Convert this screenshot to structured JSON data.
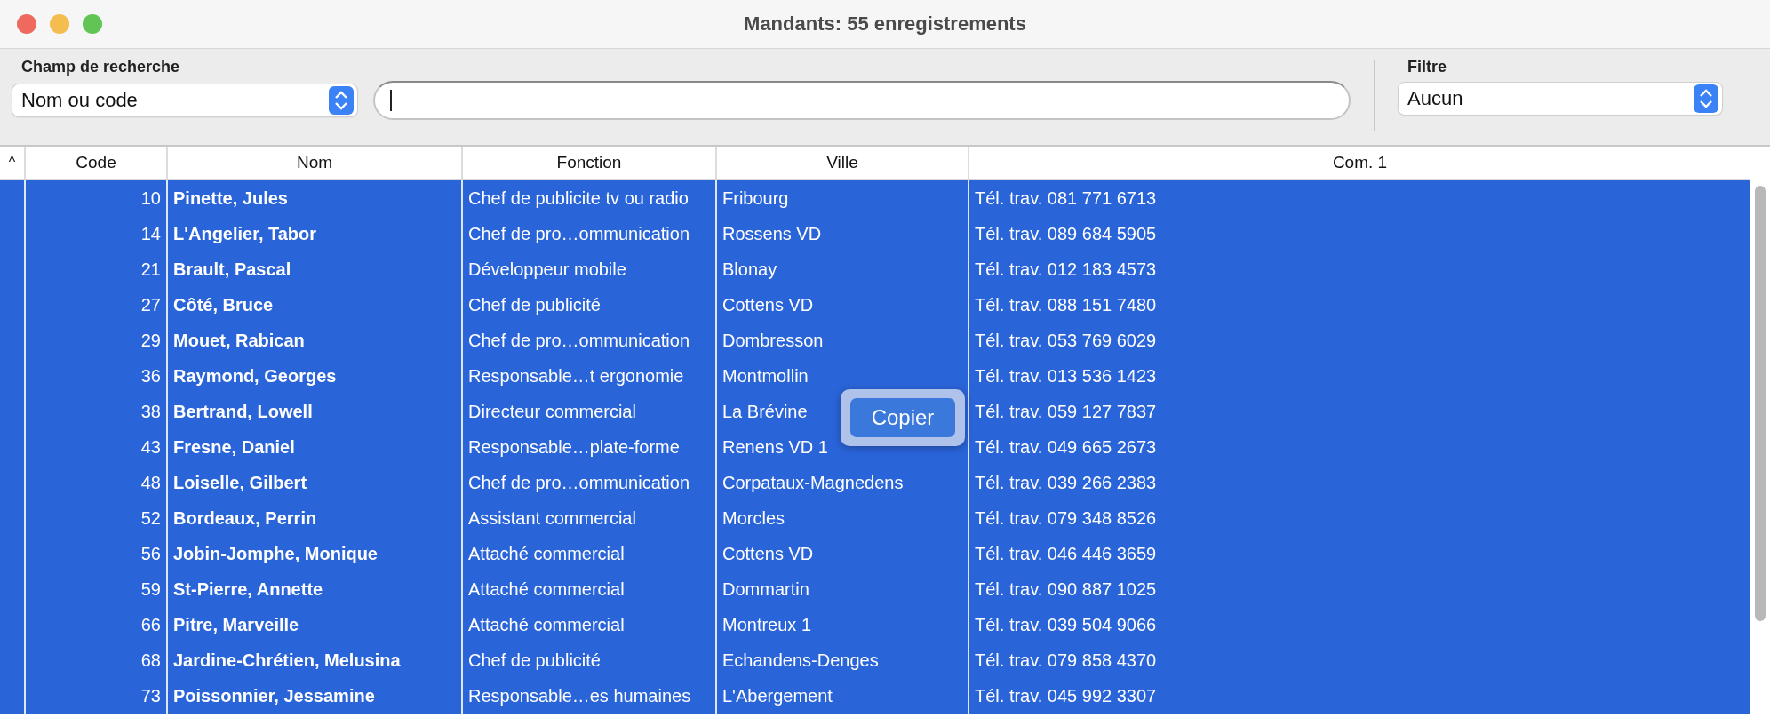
{
  "window": {
    "title": "Mandants: 55 enregistrements"
  },
  "search": {
    "field_label": "Champ de recherche",
    "field_value": "Nom ou code",
    "filter_label": "Filtre",
    "filter_value": "Aucun"
  },
  "table": {
    "sort_indicator": "^",
    "columns": [
      "Code",
      "Nom",
      "Fonction",
      "Ville",
      "Com. 1"
    ],
    "rows": [
      {
        "code": "10",
        "nom": "Pinette, Jules",
        "fonction": "Chef de publicite tv ou radio",
        "ville": "Fribourg",
        "com1": "Tél. trav. 081 771 6713",
        "selected": true
      },
      {
        "code": "14",
        "nom": "L'Angelier, Tabor",
        "fonction": "Chef de pro…ommunication",
        "ville": "Rossens VD",
        "com1": "Tél. trav. 089 684 5905",
        "selected": true
      },
      {
        "code": "21",
        "nom": "Brault, Pascal",
        "fonction": "Développeur mobile",
        "ville": "Blonay",
        "com1": "Tél. trav. 012 183 4573",
        "selected": true
      },
      {
        "code": "27",
        "nom": "Côté, Bruce",
        "fonction": "Chef de publicité",
        "ville": "Cottens VD",
        "com1": "Tél. trav. 088 151 7480",
        "selected": true
      },
      {
        "code": "29",
        "nom": "Mouet, Rabican",
        "fonction": "Chef de pro…ommunication",
        "ville": "Dombresson",
        "com1": "Tél. trav. 053 769 6029",
        "selected": true
      },
      {
        "code": "36",
        "nom": "Raymond, Georges",
        "fonction": "Responsable…t ergonomie",
        "ville": "Montmollin",
        "com1": "Tél. trav. 013 536 1423",
        "selected": true
      },
      {
        "code": "38",
        "nom": "Bertrand, Lowell",
        "fonction": "Directeur commercial",
        "ville": "La Brévine",
        "com1": "Tél. trav. 059 127 7837",
        "selected": true
      },
      {
        "code": "43",
        "nom": "Fresne, Daniel",
        "fonction": "Responsable…plate-forme",
        "ville": "Renens VD 1",
        "com1": "Tél. trav. 049 665 2673",
        "selected": true
      },
      {
        "code": "48",
        "nom": "Loiselle, Gilbert",
        "fonction": "Chef de pro…ommunication",
        "ville": "Corpataux-Magnedens",
        "com1": "Tél. trav. 039 266 2383",
        "selected": true
      },
      {
        "code": "52",
        "nom": "Bordeaux, Perrin",
        "fonction": "Assistant commercial",
        "ville": "Morcles",
        "com1": "Tél. trav. 079 348 8526",
        "selected": true
      },
      {
        "code": "56",
        "nom": "Jobin-Jomphe, Monique",
        "fonction": "Attaché commercial",
        "ville": "Cottens VD",
        "com1": "Tél. trav. 046 446 3659",
        "selected": true
      },
      {
        "code": "59",
        "nom": "St-Pierre, Annette",
        "fonction": "Attaché commercial",
        "ville": "Dommartin",
        "com1": "Tél. trav. 090 887 1025",
        "selected": true
      },
      {
        "code": "66",
        "nom": "Pitre, Marveille",
        "fonction": "Attaché commercial",
        "ville": "Montreux 1",
        "com1": "Tél. trav. 039 504 9066",
        "selected": true
      },
      {
        "code": "68",
        "nom": "Jardine-Chrétien, Melusina",
        "fonction": "Chef de publicité",
        "ville": "Echandens-Denges",
        "com1": "Tél. trav. 079 858 4370",
        "selected": true
      },
      {
        "code": "73",
        "nom": "Poissonnier, Jessamine",
        "fonction": "Responsable…es humaines",
        "ville": "L'Abergement",
        "com1": "Tél. trav. 045 992 3307",
        "selected": true
      }
    ]
  },
  "popup": {
    "button": "Copier"
  }
}
